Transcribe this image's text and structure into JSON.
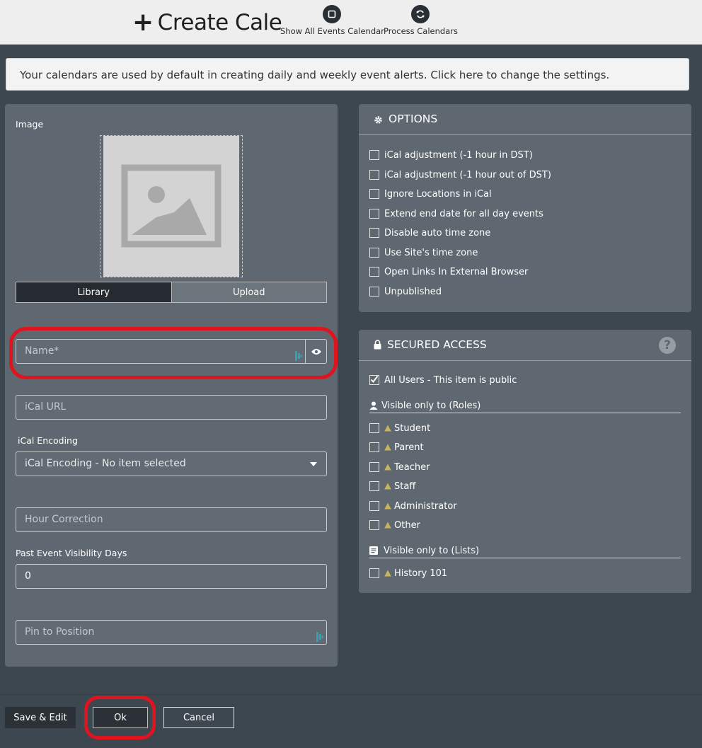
{
  "header": {
    "title": "Create Cale",
    "plus_glyph": "+",
    "buttons": [
      {
        "label": "Show All Events Calendar",
        "icon": "square-icon"
      },
      {
        "label": "Process Calendars",
        "icon": "sync-icon"
      }
    ]
  },
  "notice": "Your calendars are used by default in creating daily and weekly event alerts. Click here to change the settings.",
  "form": {
    "image_label": "Image",
    "image_tabs": {
      "library": "Library",
      "upload": "Upload",
      "selected": "Library"
    },
    "name": {
      "placeholder": "Name*",
      "value": ""
    },
    "ical_url": {
      "placeholder": "iCal URL",
      "value": ""
    },
    "ical_encoding": {
      "label": "iCal Encoding",
      "selected": "iCal Encoding - No item selected"
    },
    "hour_correction": {
      "placeholder": "Hour Correction",
      "value": ""
    },
    "past_event_visibility": {
      "label": "Past Event Visibility Days",
      "value": "0"
    },
    "pin_to_position": {
      "placeholder": "Pin to Position",
      "value": ""
    }
  },
  "options": {
    "title": "OPTIONS",
    "items": [
      {
        "label": "iCal adjustment (-1 hour in DST)",
        "checked": false
      },
      {
        "label": "iCal adjustment (-1 hour out of DST)",
        "checked": false
      },
      {
        "label": "Ignore Locations in iCal",
        "checked": false
      },
      {
        "label": "Extend end date for all day events",
        "checked": false
      },
      {
        "label": "Disable auto time zone",
        "checked": false
      },
      {
        "label": "Use Site's time zone",
        "checked": false
      },
      {
        "label": "Open Links In External Browser",
        "checked": false
      },
      {
        "label": "Unpublished",
        "checked": false
      }
    ]
  },
  "secured_access": {
    "title": "SECURED ACCESS",
    "help_glyph": "?",
    "public": {
      "label": "All Users - This item is public",
      "checked": true
    },
    "roles_heading": "Visible only to (Roles)",
    "roles": [
      {
        "label": "Student",
        "checked": false
      },
      {
        "label": "Parent",
        "checked": false
      },
      {
        "label": "Teacher",
        "checked": false
      },
      {
        "label": "Staff",
        "checked": false
      },
      {
        "label": "Administrator",
        "checked": false
      },
      {
        "label": "Other",
        "checked": false
      }
    ],
    "lists_heading": "Visible only to (Lists)",
    "lists": [
      {
        "label": "History 101",
        "checked": false
      }
    ]
  },
  "footer": {
    "save_edit": "Save & Edit",
    "ok": "Ok",
    "cancel": "Cancel"
  },
  "colors": {
    "highlight": "#e0141e",
    "warning": "#c8b45a",
    "panel": "#5f6870",
    "background": "#3d4750"
  }
}
